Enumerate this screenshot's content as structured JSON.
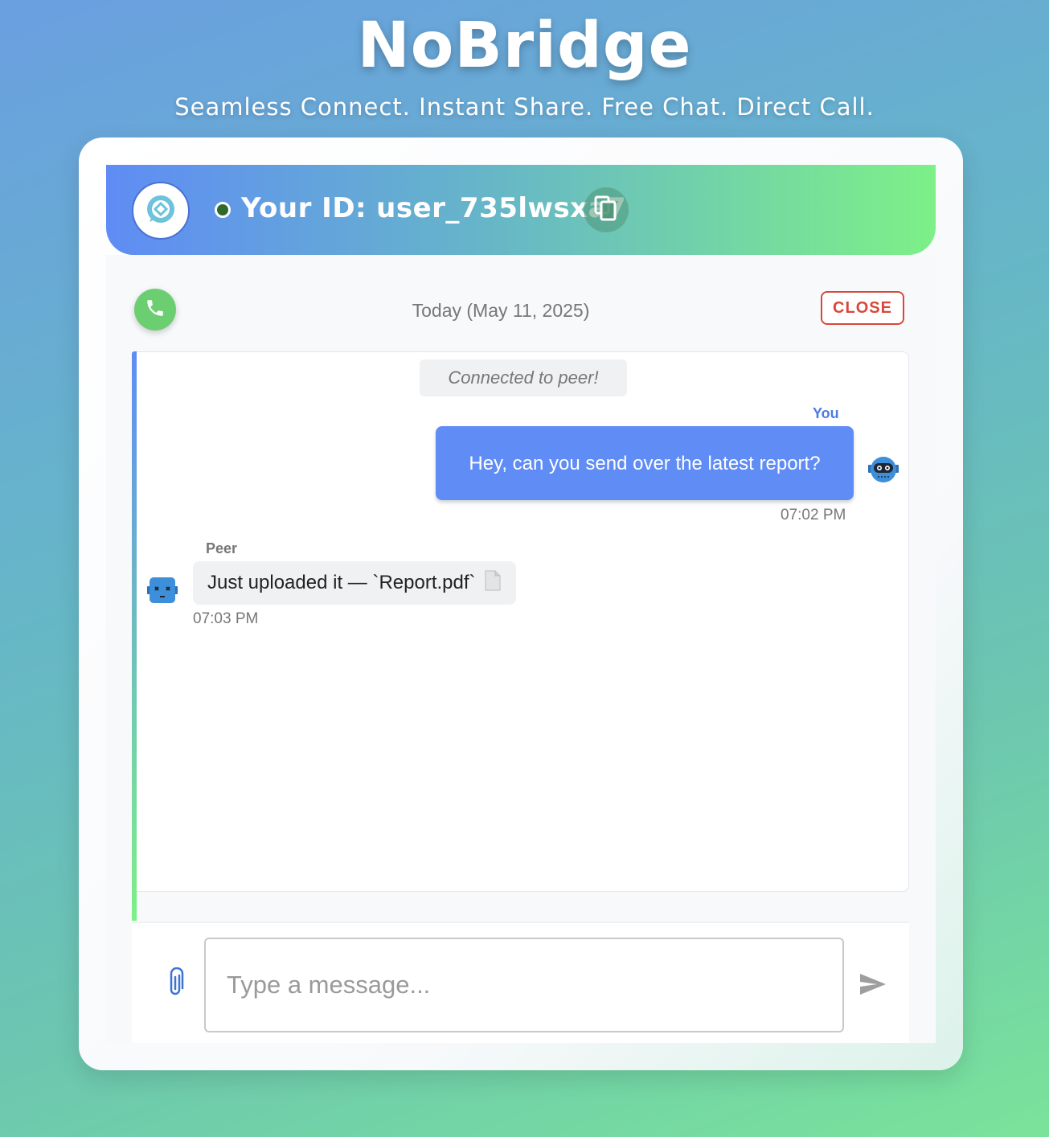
{
  "app": {
    "title": "NoBridge",
    "tagline": "Seamless Connect. Instant Share. Free Chat. Direct Call."
  },
  "header": {
    "logo_icon": "chat-bubble-icon",
    "status": "online",
    "id_label": "Your ID:",
    "user_id": "user_735lwsxa7",
    "copy_icon": "copy-icon"
  },
  "chat": {
    "call_icon": "phone-icon",
    "date_label": "Today (May 11, 2025)",
    "close_label": "CLOSE",
    "system_message": "Connected to peer!",
    "messages": [
      {
        "sender": "You",
        "text": "Hey, can you send over the latest report?",
        "time": "07:02 PM",
        "avatar_icon": "robot-avatar-icon"
      },
      {
        "sender": "Peer",
        "text": "Just uploaded it — `Report.pdf`",
        "time": "07:03 PM",
        "attachment_icon": "document-icon",
        "avatar_icon": "robot-dead-avatar-icon"
      }
    ]
  },
  "composer": {
    "attach_icon": "paperclip-icon",
    "placeholder": "Type a message...",
    "value": "",
    "send_icon": "send-icon"
  },
  "colors": {
    "accent_blue": "#5f8cf5",
    "accent_green": "#7df087",
    "call_green": "#6bcf72",
    "close_red": "#d9473a"
  }
}
